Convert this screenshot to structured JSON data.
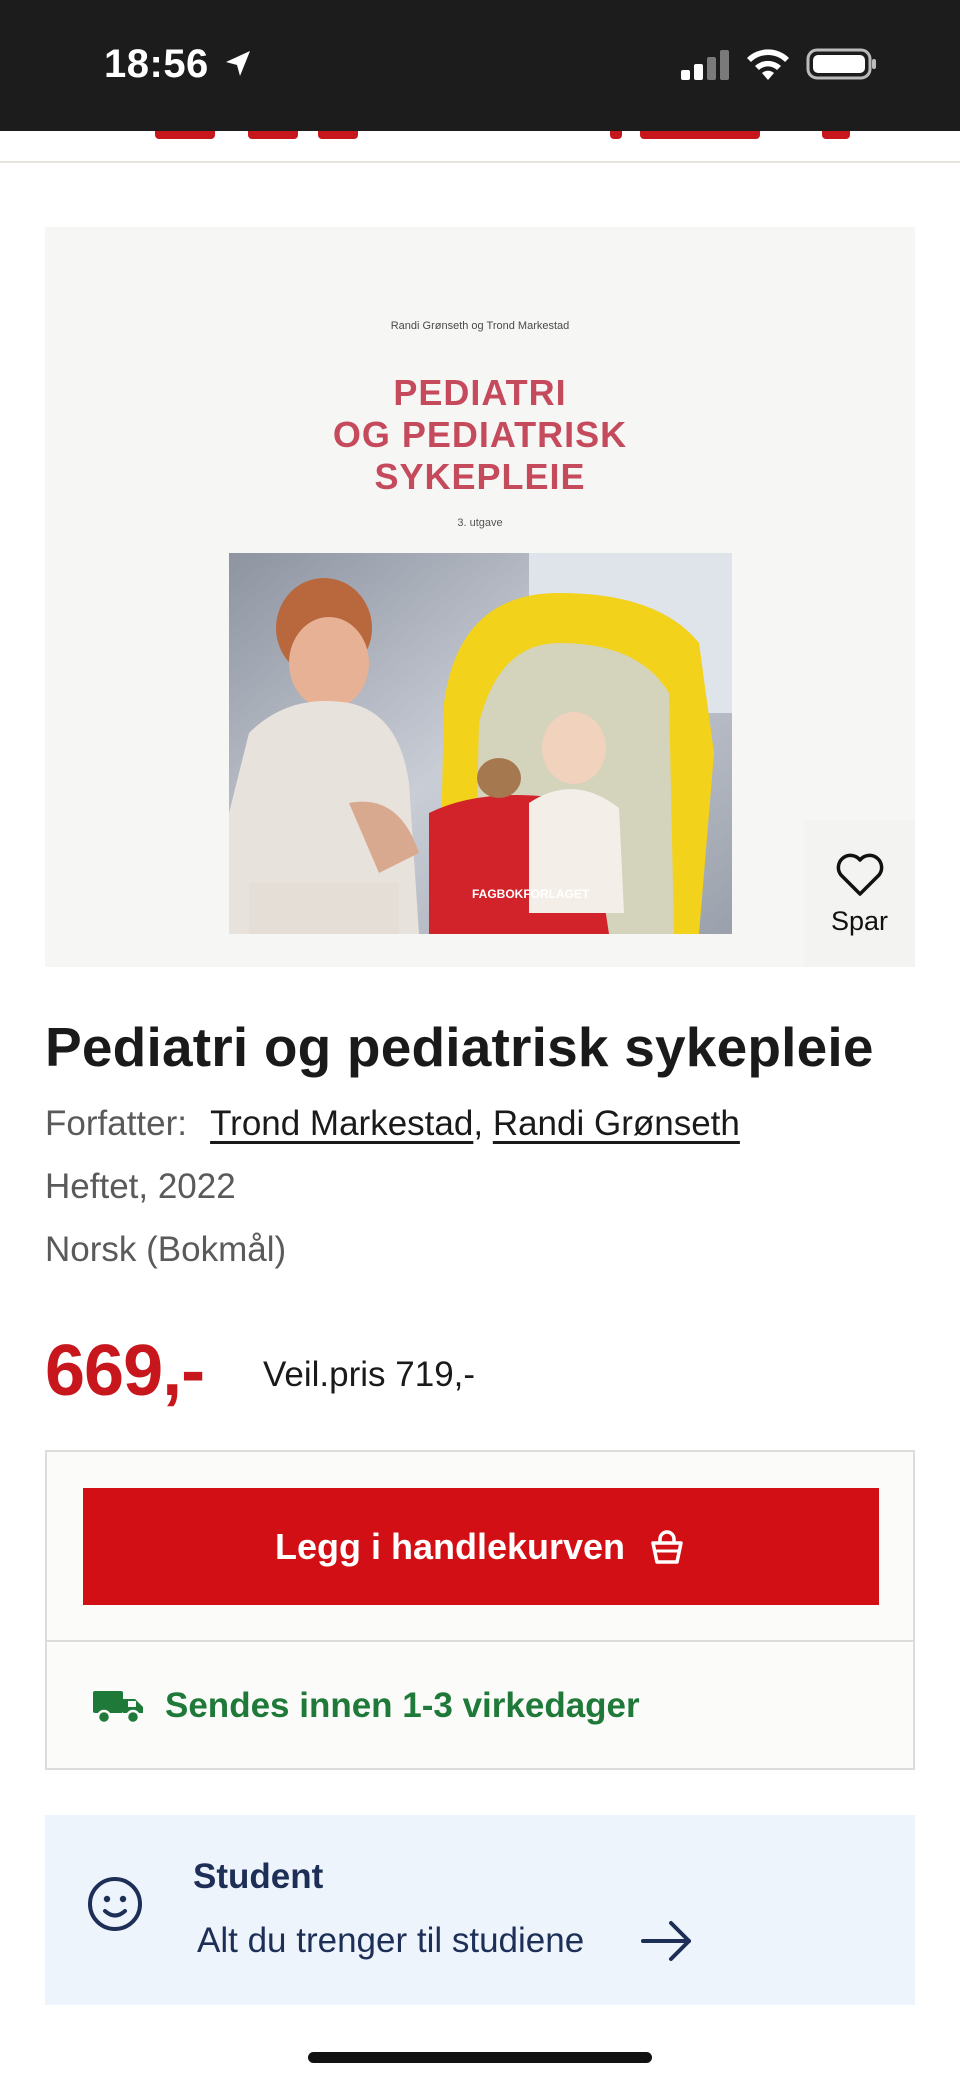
{
  "status_bar": {
    "time": "18:56",
    "location_icon": "location-arrow-icon",
    "signal_icon": "cellular-signal-icon",
    "wifi_icon": "wifi-icon",
    "battery_icon": "battery-icon"
  },
  "product": {
    "cover": {
      "authors": "Randi Grønseth og Trond Markestad",
      "title_lines": [
        "PEDIATRI",
        "OG PEDIATRISK",
        "SYKEPLEIE"
      ],
      "edition": "3. utgave",
      "publisher": "FAGBOKFORLAGET"
    },
    "save_label": "Spar",
    "title": "Pediatri og pediatrisk sykepleie",
    "author_label": "Forfatter:",
    "authors": [
      "Trond Markestad",
      "Randi Grønseth"
    ],
    "author_separator": ",",
    "format": "Heftet, 2022",
    "language": "Norsk (Bokmål)",
    "price": "669,-",
    "list_price": "Veil.pris 719,-"
  },
  "buy": {
    "cart_button_label": "Legg i handlekurven",
    "cart_icon": "shopping-basket-icon",
    "delivery_text": "Sendes innen 1-3 virkedager",
    "delivery_icon": "delivery-truck-icon"
  },
  "student": {
    "title": "Student",
    "subtitle": "Alt du trenger til studiene",
    "icon": "smiley-face-icon",
    "arrow_icon": "arrow-right-icon"
  },
  "colors": {
    "accent_red": "#d10f14",
    "price_red": "#c8161d",
    "delivery_green": "#1f7a3a",
    "student_navy": "#1e2f57",
    "student_bg": "#eef4fb"
  }
}
